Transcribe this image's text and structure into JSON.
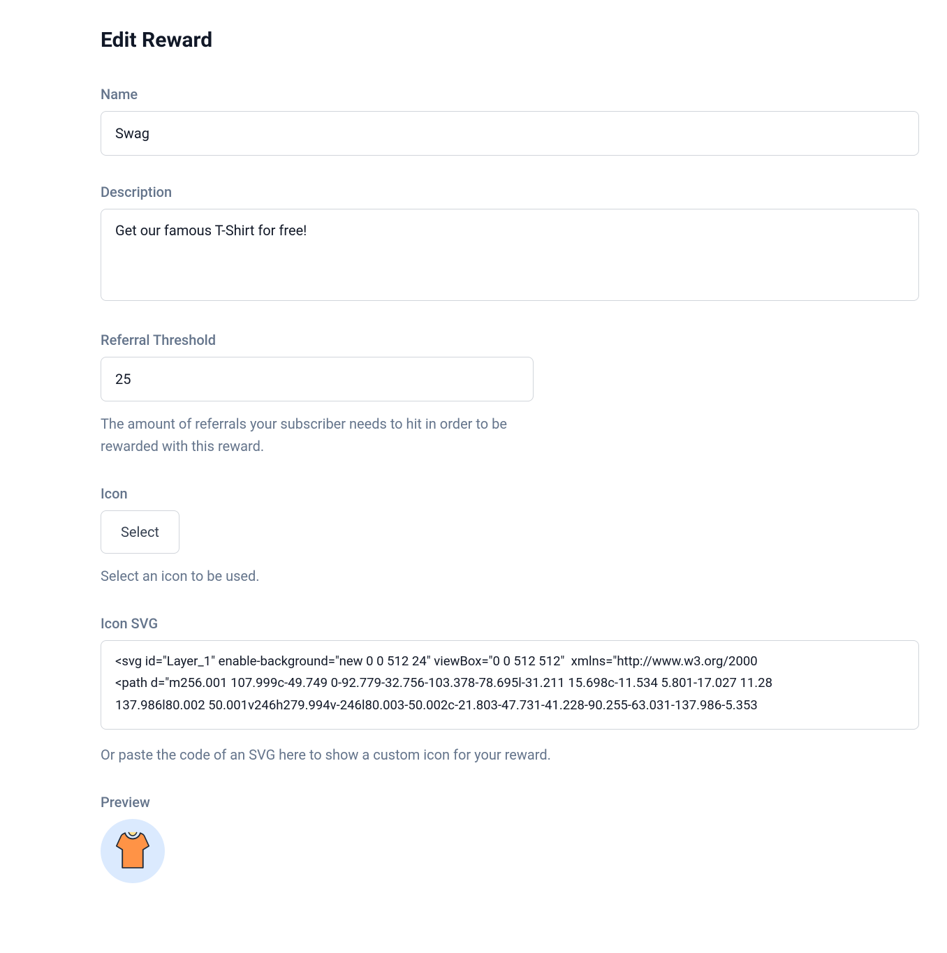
{
  "page_title": "Edit Reward",
  "name_field": {
    "label": "Name",
    "value": "Swag"
  },
  "description_field": {
    "label": "Description",
    "value": "Get our famous T-Shirt for free!"
  },
  "threshold_field": {
    "label": "Referral Threshold",
    "value": "25",
    "helper": "The amount of referrals your subscriber needs to hit in order to be rewarded with this reward."
  },
  "icon_field": {
    "label": "Icon",
    "button_label": "Select",
    "helper": "Select an icon to be used."
  },
  "icon_svg_field": {
    "label": "Icon SVG",
    "value": "<svg id=\"Layer_1\" enable-background=\"new 0 0 512 24\" viewBox=\"0 0 512 512\"  xmlns=\"http://www.w3.org/2000\n<path d=\"m256.001 107.999c-49.749 0-92.779-32.756-103.378-78.695l-31.211 15.698c-11.534 5.801-17.027 11.28\n137.986l80.002 50.001v246h279.994v-246l80.003-50.002c-21.803-47.731-41.228-90.255-63.031-137.986-5.353",
    "helper": "Or paste the code of an SVG here to show a custom icon for your reward."
  },
  "preview_field": {
    "label": "Preview",
    "icon_name": "tshirt-icon"
  }
}
